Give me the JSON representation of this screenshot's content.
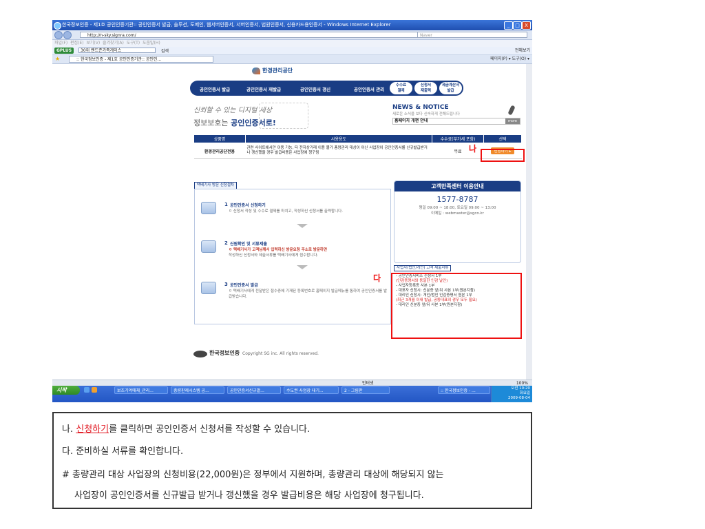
{
  "window": {
    "title": "한국정보인증 - 제1호 공인인증기관:: 공인인증서 발급, 솔루션, 도메인, 웹서버인증서, 서버인증서, 법원인증서, 신용카드용인증서 - Windows Internet Explorer",
    "min": "_",
    "max": "□",
    "close": "X"
  },
  "address_bar": {
    "url": "http://n-sky.signra.com/",
    "search_placeholder": "Naver"
  },
  "menu": [
    "파일(F)",
    "편집(E)",
    "보기(V)",
    "즐겨찾기(A)",
    "도구(T)",
    "도움말(H)"
  ],
  "plus_toolbar": {
    "brand": "GPLUS",
    "combo": "30위 밴드존가족게이스",
    "search_btn": "검색",
    "right": "전체보기"
  },
  "tab_bar": {
    "tab_title": ":: 한국정보인증 - 제1호 공인인증기관:: 공인인...",
    "tools": "페이지(P) ▾  도구(O) ▾"
  },
  "page": {
    "logo_text": "한경관리공단",
    "nav": [
      "공인인증서 발급",
      "공인인증서 재발급",
      "공인인증서 갱신",
      "공인인증서 관리"
    ],
    "nav_sub": [
      {
        "l1": "수수료",
        "l2": "결제"
      },
      {
        "l1": "신청서",
        "l2": "재출력"
      },
      {
        "l1": "세금계산서",
        "l2": "발급"
      }
    ],
    "hero": {
      "line1": "신뢰할 수 있는 디지털 세상",
      "line2_prefix": "정보보호는 ",
      "line2_bold": "공인인증서로!"
    },
    "news": {
      "title": "NEWS & NOTICE",
      "subtitle": "새로운 소식을 보다 신속하게 전해드립니다",
      "item": "홈페이지 개편 안내",
      "more": "more"
    },
    "product_table": {
      "headers": [
        "상품명",
        "사용용도",
        "수수료(부가세 포함)",
        "선택"
      ],
      "row": {
        "name": "환경관리공단전용",
        "usage": "관련 사이트에서만 이용 가능, 타 전자상거래 이용 불가 총량관리 대상이 아닌 사업장이 공인인증서를 신규발급받거나 갱신했을 경우 발급비용은 사업장에 청구됨",
        "fee": "무료",
        "button": "신청하기 ▸"
      }
    },
    "marker_na": "나",
    "marker_da": "다",
    "steps_title": "택배기사 방문 신청절차",
    "steps": [
      {
        "num": "1",
        "title": "공인인증서 신청하기",
        "desc": "ㅇ 신청서 작성 및 수수료 결제를 마치고, 작성하신 신청서를 출력합니다.",
        "highlight": ""
      },
      {
        "num": "2",
        "title": "신원확인 및 서류제출",
        "desc": "작성하신 신청서와 제출서류를 택배기사에게 접수합니다.",
        "highlight": "ㅇ 택배기사가 고객님께서 입력하신 방문요청 주소로 방문하면"
      },
      {
        "num": "3",
        "title": "공인인증서 발급",
        "desc": "ㅇ 택배기사에게 전달받은 접수증에 기재된 등록번호로 홈페이지 발급메뉴를 통하여 공인인증서를 발급받습니다.",
        "highlight": ""
      }
    ],
    "customer_center": {
      "title": "고객만족센터 이용안내",
      "phone": "1577-8787",
      "hours": "평일 09:00 ~ 18:00, 토요일 09:00 ~ 13:00",
      "email": "이메일 : webmaster@sgco.kr"
    },
    "docs": {
      "title": "사업자(법인/개인) 고객 제출서류",
      "items": [
        {
          "text": "- 공인인증서비스 신청서 1부",
          "red": false
        },
        {
          "text": "(인감증명서와 동일한 인감 날인)",
          "red": true
        },
        {
          "text": "- 사업자등록증 사본 1부",
          "red": false
        },
        {
          "text": "- 대표자 신청시: 신분증 앞/뒤 사본 1부(원본지참)",
          "red": false
        },
        {
          "text": "- 대리인 신청시: 개인/법인 인감증명서 원본 1부",
          "red": false
        },
        {
          "text": "(최근 3개월 이내 발급, 공동대표의 경우 모두 필요)",
          "red": true
        },
        {
          "text": "- 대리인 신분증 앞/뒤 사본 1부(원본지참)",
          "red": false
        }
      ]
    },
    "footer": {
      "brand": "한국정보인증",
      "copyright": "Copyright SG inc. All rights reserved."
    }
  },
  "statusbar": {
    "zone": "인터넷",
    "zoom": "100%"
  },
  "taskbar": {
    "start": "시작",
    "tasks": [
      "보조기억매체_관리...",
      "총량판제시스템 공...",
      "공인인증서신규발...",
      "수도권 사업장 대기...",
      "2 - 그림판",
      ":: 한국정보인증 - ..."
    ],
    "clock_ampm": "오전 10:20",
    "clock_day": "화요일",
    "clock_date": "2009-08-04"
  },
  "description": {
    "line1_prefix": "나. ",
    "line1_link": "신청하기",
    "line1_suffix": "를 클릭하면 공인인증서 신청서를 작성할 수 있습니다.",
    "line2": "다. 준비하실 서류를 확인합니다.",
    "line3": "# 총량관리 대상 사업장의 신청비용(22,000원)은 정부에서 지원하며, 총량관리 대상에 해당되지 않는",
    "line4": "사업장이 공인인증서를 신규발급 받거나 갱신했을 경우 발급비용은 해당 사업장에 청구됩니다."
  }
}
